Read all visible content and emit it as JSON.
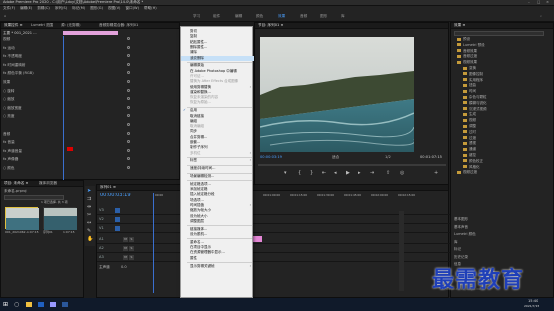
{
  "window": {
    "title": "Adobe Premiere Pro 2020 - C:\\用户\\Ldxy\\文档\\Adobe\\Premiere Pro\\14.0\\未命名 *"
  },
  "menubar": [
    "文件(F)",
    "编辑(E)",
    "剪辑(C)",
    "序列(S)",
    "标记(M)",
    "图形(G)",
    "视图(V)",
    "窗口(W)",
    "帮助(H)"
  ],
  "workspaces": [
    {
      "label": "学习",
      "active": false
    },
    {
      "label": "组件",
      "active": false
    },
    {
      "label": "编辑",
      "active": false
    },
    {
      "label": "颜色",
      "active": false
    },
    {
      "label": "效果",
      "active": true
    },
    {
      "label": "音频",
      "active": false
    },
    {
      "label": "图形",
      "active": false
    },
    {
      "label": "库",
      "active": false
    }
  ],
  "effect_controls": {
    "tabs": [
      "效果控件 ≡",
      "Lumetri 范围",
      "源: (无剪辑)",
      "音频剪辑混合器: 序列01"
    ],
    "source": "主要 * 001_2021 ...",
    "props": [
      {
        "label": "视频",
        "value": ""
      },
      {
        "label": "fx 运动",
        "value": ""
      },
      {
        "label": "fx 不透明度",
        "value": ""
      },
      {
        "label": "fx 时间重映射",
        "value": ""
      },
      {
        "label": "fx 颜色平衡 (RGB)",
        "value": ""
      },
      {
        "label": "效果",
        "value": ""
      },
      {
        "label": "○ 旋转",
        "value": ""
      },
      {
        "label": "○ 缩放",
        "value": ""
      },
      {
        "label": "○ 缩放宽度",
        "value": ""
      },
      {
        "label": "○ 亮度",
        "value": ""
      },
      {
        "label": "",
        "value": ""
      },
      {
        "label": "音频",
        "value": ""
      },
      {
        "label": "fx 音量",
        "value": ""
      },
      {
        "label": "fx 声道音量",
        "value": ""
      },
      {
        "label": "fx 声像器",
        "value": ""
      },
      {
        "label": "○ 颜色",
        "value": ""
      }
    ],
    "footer_time": "00:00:03:19"
  },
  "context_menu": {
    "items": [
      {
        "label": "剪切",
        "state": "normal"
      },
      {
        "label": "复制",
        "state": "normal"
      },
      {
        "label": "粘贴属性...",
        "state": "normal"
      },
      {
        "label": "删除属性...",
        "state": "normal"
      },
      {
        "label": "清除",
        "state": "normal"
      },
      {
        "label": "波纹删除",
        "state": "highlight"
      },
      {
        "label": "sep"
      },
      {
        "label": "编辑原始",
        "state": "normal"
      },
      {
        "label": "在 Adobe Photoshop 中编辑",
        "state": "normal"
      },
      {
        "label": "许可证...",
        "state": "disabled"
      },
      {
        "label": "替换为 After Effects 合成图像",
        "state": "disabled"
      },
      {
        "label": "使用剪辑替换",
        "state": "normal",
        "sub": true
      },
      {
        "label": "渲染和替换...",
        "state": "normal"
      },
      {
        "label": "恢复未渲染的内容",
        "state": "disabled"
      },
      {
        "label": "恢复为原始...",
        "state": "disabled"
      },
      {
        "label": "sep"
      },
      {
        "label": "启用",
        "state": "normal",
        "check": true
      },
      {
        "label": "取消链接",
        "state": "normal"
      },
      {
        "label": "编组",
        "state": "normal"
      },
      {
        "label": "取消编组",
        "state": "disabled"
      },
      {
        "label": "同步",
        "state": "normal"
      },
      {
        "label": "合并剪辑...",
        "state": "normal"
      },
      {
        "label": "嵌套...",
        "state": "normal"
      },
      {
        "label": "制作子序列",
        "state": "normal"
      },
      {
        "label": "多机位",
        "state": "disabled",
        "sub": true
      },
      {
        "label": "sep"
      },
      {
        "label": "标签",
        "state": "normal",
        "sub": true
      },
      {
        "label": "sep"
      },
      {
        "label": "速度/持续时间...",
        "state": "normal"
      },
      {
        "label": "sep"
      },
      {
        "label": "场景编辑检测...",
        "state": "normal"
      },
      {
        "label": "sep"
      },
      {
        "label": "帧定格选项...",
        "state": "normal"
      },
      {
        "label": "添加帧定格",
        "state": "normal"
      },
      {
        "label": "插入帧定格分段",
        "state": "normal"
      },
      {
        "label": "场选项...",
        "state": "normal"
      },
      {
        "label": "时间插值",
        "state": "normal",
        "sub": true
      },
      {
        "label": "缩放为帧大小",
        "state": "normal"
      },
      {
        "label": "设为帧大小",
        "state": "normal"
      },
      {
        "label": "调整图层",
        "state": "normal"
      },
      {
        "label": "sep"
      },
      {
        "label": "链接媒体...",
        "state": "normal"
      },
      {
        "label": "设为脱机...",
        "state": "normal"
      },
      {
        "label": "sep"
      },
      {
        "label": "重命名...",
        "state": "normal"
      },
      {
        "label": "在项目中显示",
        "state": "normal"
      },
      {
        "label": "在资源管理器中显示...",
        "state": "normal"
      },
      {
        "label": "属性",
        "state": "normal"
      },
      {
        "label": "sep"
      },
      {
        "label": "显示剪辑关键帧",
        "state": "normal",
        "sub": true
      }
    ]
  },
  "program_monitor": {
    "tab": "节目: 序列01 ≡",
    "timecode_left": "00:00:03:19",
    "fit": "适合",
    "ratio": "1/2",
    "timecode_right": "00:01:07:15"
  },
  "project": {
    "tabs": [
      "项目: 未命名 ≡",
      "媒体浏览器"
    ],
    "path": "未命名.prproj",
    "items_label": "1 项已选择, 共 3 项",
    "clips": [
      {
        "name": "001_2021062...",
        "dur": "1:07:15"
      },
      {
        "name": "序列01",
        "dur": "1:07:15"
      }
    ]
  },
  "timeline": {
    "tab": "序列01 ≡",
    "timecode": "00:00:03:19",
    "ruler": [
      "00:00",
      "00:00:15:00",
      "00:00:30:00",
      "00:00:45:00",
      "00:01:00:00",
      "00:01:15:00",
      "00:01:30:00",
      "00:01:45:00",
      "00:02:00:00",
      "00:02:15:00"
    ],
    "video_tracks": [
      "V3",
      "V2",
      "V1"
    ],
    "audio_tracks": [
      "A1",
      "A2",
      "A3"
    ],
    "master": "主声道",
    "master_val": "0.0"
  },
  "effects_panel": {
    "tab": "效果 ≡",
    "tree": [
      "预设",
      "Lumetri 预设",
      "音频效果",
      "音频过渡",
      "视频效果",
      "变换",
      "图像控制",
      "实用程序",
      "扭曲",
      "时间",
      "杂色与颗粒",
      "模糊与锐化",
      "沉浸式视频",
      "生成",
      "视频",
      "调整",
      "过时",
      "过渡",
      "透视",
      "通道",
      "键控",
      "颜色校正",
      "风格化",
      "视频过渡"
    ],
    "footer": [
      "基本图形",
      "基本声音",
      "Lumetri 颜色",
      "库",
      "标记",
      "历史记录",
      "信息"
    ]
  },
  "taskbar": {
    "time": "15:40",
    "date": "2021/7/15"
  },
  "watermark": {
    "logo": "最需教育",
    "sub": "www.zuixujiaoyu.com"
  },
  "colors": {
    "accent": "#4ba0ff",
    "clip_video": "#6b5bd8",
    "clip_pink": "#e487d6",
    "menu_bg": "#f0f0f0",
    "menu_hl": "#c6e0f7"
  }
}
